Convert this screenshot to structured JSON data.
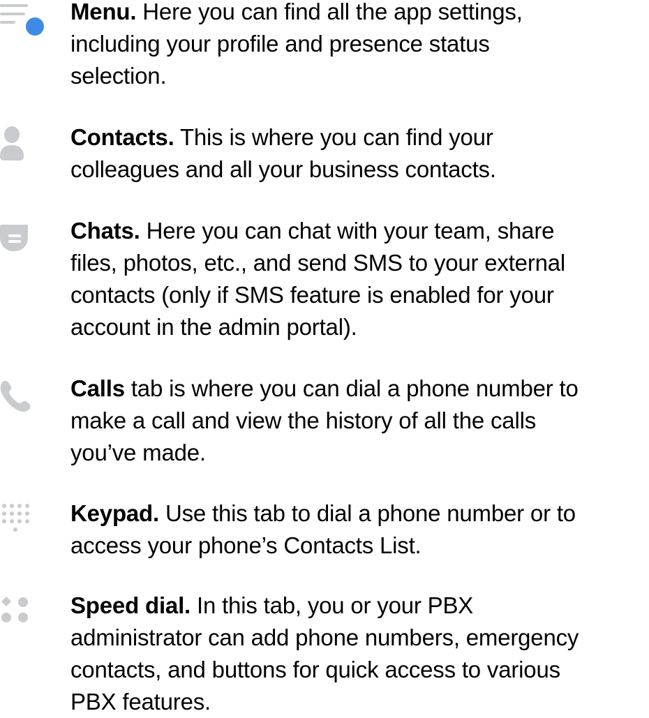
{
  "colors": {
    "icon_gray": "#c9cbce",
    "accent_blue": "#3e8ae6",
    "text": "#000000"
  },
  "items": [
    {
      "icon": "menu-icon",
      "term": "Menu.",
      "lines": [
        " Here you can find all the app settings,",
        "including your profile and presence status",
        "selection."
      ]
    },
    {
      "icon": "contacts-icon",
      "term": "Contacts.",
      "lines": [
        " This is where you can find your",
        "colleagues and all your business contacts."
      ]
    },
    {
      "icon": "chats-icon",
      "term": "Chats.",
      "lines": [
        " Here you can chat with your team, share",
        "files, photos, etc., and send SMS to your external",
        "contacts (only if SMS feature is enabled for your",
        "account in the admin portal)."
      ]
    },
    {
      "icon": "calls-icon",
      "term": "Calls",
      "lines": [
        " tab is where you can dial a phone number to",
        "make a call and view the history of all the calls",
        "you’ve made."
      ]
    },
    {
      "icon": "keypad-icon",
      "term": "Keypad.",
      "lines": [
        " Use this tab to dial a phone number or to",
        "access your phone’s Contacts List."
      ]
    },
    {
      "icon": "speed-dial-icon",
      "term": "Speed dial.",
      "lines": [
        " In this tab, you or your PBX",
        "administrator can add phone numbers, emergency",
        "contacts, and buttons for quick access to various",
        "PBX features."
      ]
    }
  ]
}
